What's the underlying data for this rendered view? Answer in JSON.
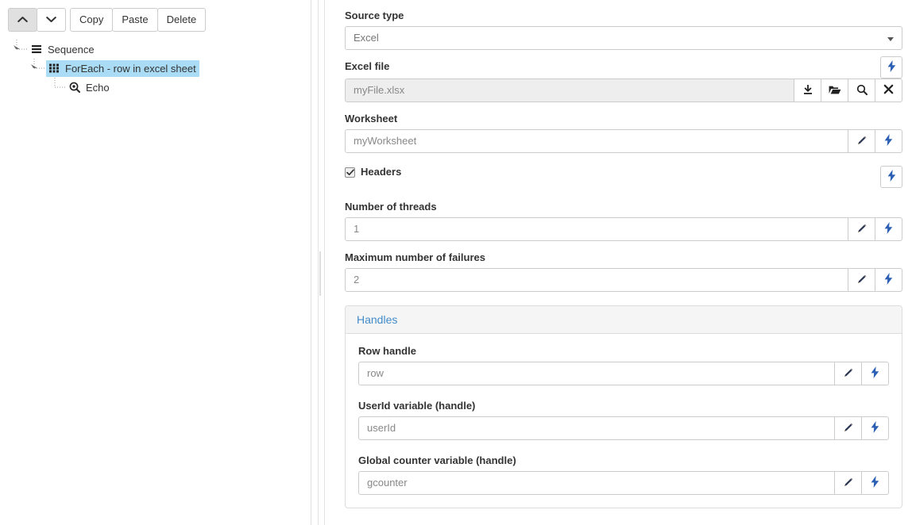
{
  "toolbar": {
    "move_up": {
      "icon": "chevron-up-icon",
      "label": ""
    },
    "move_down": {
      "icon": "chevron-down-icon",
      "label": ""
    },
    "copy": "Copy",
    "paste": "Paste",
    "delete": "Delete"
  },
  "tree": {
    "nodes": [
      {
        "label": "Sequence",
        "icon": "sequence-icon",
        "depth": 0,
        "selected": false
      },
      {
        "label": "ForEach - row in excel sheet",
        "icon": "grid-icon",
        "depth": 1,
        "selected": true
      },
      {
        "label": "Echo",
        "icon": "magnifier-dot-icon",
        "depth": 2,
        "selected": false
      }
    ]
  },
  "form": {
    "source_type": {
      "label": "Source type",
      "value": "Excel",
      "options": [
        "Excel"
      ]
    },
    "excel_file": {
      "label": "Excel file",
      "value": "myFile.xlsx",
      "buttons": [
        "download-icon",
        "folder-open-icon",
        "search-icon",
        "clear-x-icon"
      ],
      "bolt": "lightning-bolt-icon"
    },
    "worksheet": {
      "label": "Worksheet",
      "value": "myWorksheet"
    },
    "headers": {
      "label": "Headers",
      "checked": true
    },
    "number_of_threads": {
      "label": "Number of threads",
      "value": "1"
    },
    "maximum_number_of_failures": {
      "label": "Maximum number of failures",
      "value": "2"
    }
  },
  "handles_panel": {
    "title": "Handles",
    "fields": [
      {
        "label": "Row handle",
        "value": "row"
      },
      {
        "label": "UserId variable (handle)",
        "value": "userId"
      },
      {
        "label": "Global counter variable (handle)",
        "value": "gcounter"
      }
    ]
  },
  "colors": {
    "selection": "#aadcf5",
    "link": "#428bca",
    "bolt": "#2b5fb3",
    "border": "#cccccc",
    "panel_head": "#f5f5f5",
    "readonly_bg": "#eeeeee"
  }
}
